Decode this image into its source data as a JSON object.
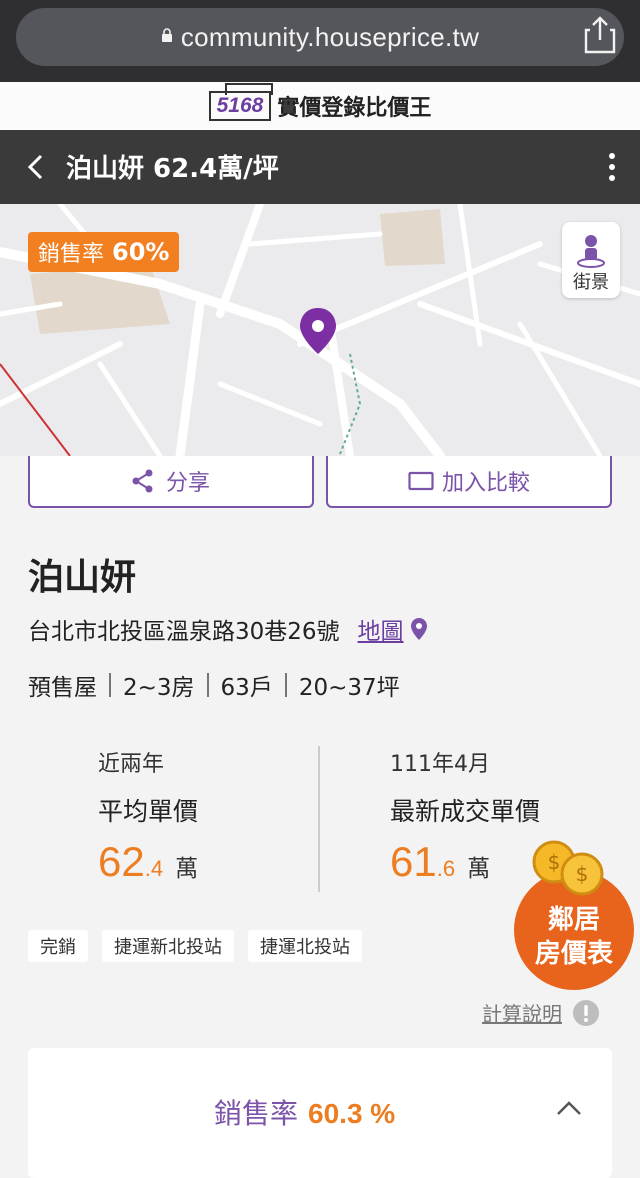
{
  "browser": {
    "url": "community.houseprice.tw"
  },
  "brand": {
    "logo": "5168",
    "name": "實價登錄比價王"
  },
  "header": {
    "title": "泊山妍 62.4萬/坪"
  },
  "map": {
    "sales_badge_label": "銷售率",
    "sales_badge_value": "60%",
    "street_view_label": "街景"
  },
  "actions": {
    "share_label": "分享",
    "compare_label": "加入比較"
  },
  "project": {
    "name": "泊山妍",
    "address": "台北市北投區溫泉路30巷26號",
    "map_link": "地圖",
    "meta": [
      "預售屋",
      "2~3房",
      "63戶",
      "20~37坪"
    ]
  },
  "stats": {
    "left": {
      "period": "近兩年",
      "title": "平均單價",
      "price_int": "62",
      "price_dec": ".4",
      "unit": "萬"
    },
    "right": {
      "period": "111年4月",
      "title": "最新成交單價",
      "price_int": "61",
      "price_dec": ".6",
      "unit": "萬"
    }
  },
  "tags": [
    "完銷",
    "捷運新北投站",
    "捷運北投站"
  ],
  "fab": {
    "line1": "鄰居",
    "line2": "房價表"
  },
  "calc_label": "計算說明",
  "sales_card": {
    "label": "銷售率",
    "value": "60.3 %"
  },
  "colors": {
    "accent_purple": "#7b53a8",
    "accent_orange": "#ec7e21",
    "header_dark": "#3a3a3a"
  }
}
